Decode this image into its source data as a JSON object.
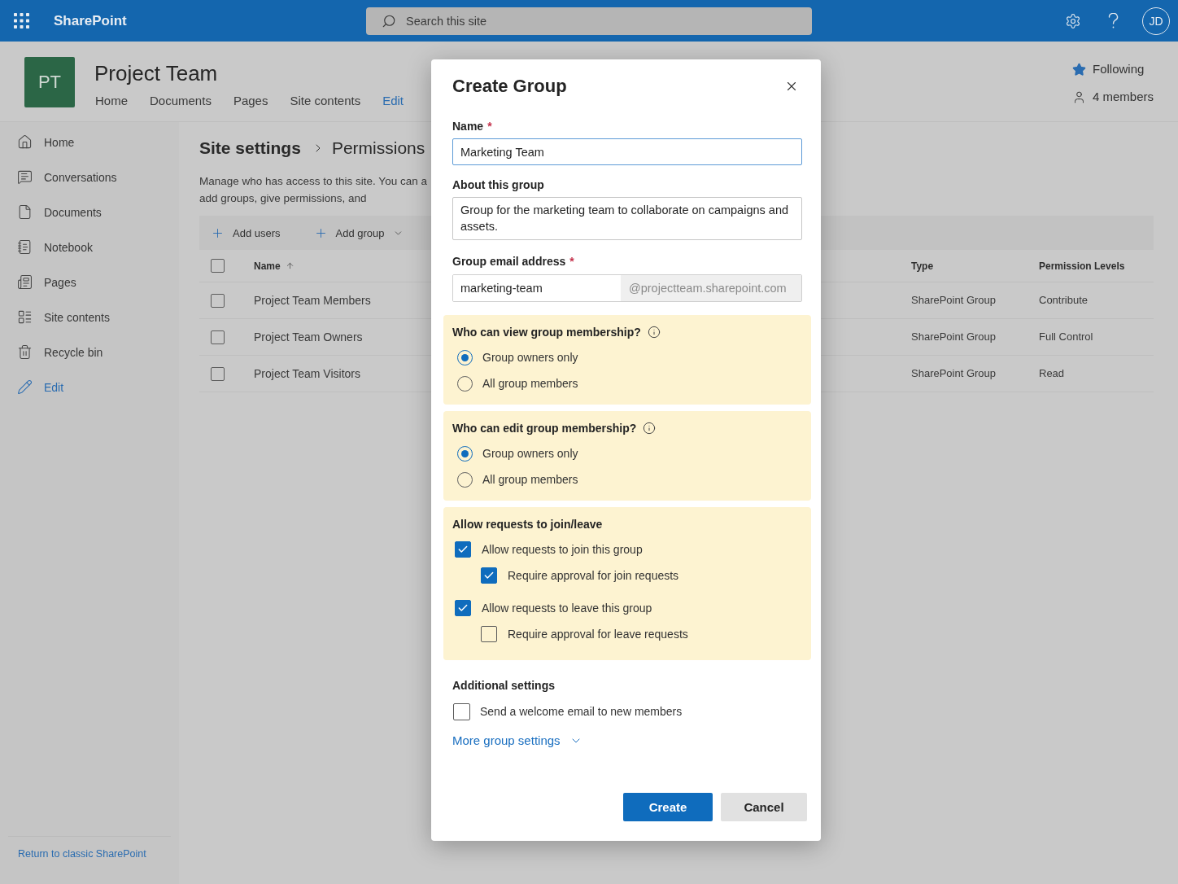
{
  "top_bar": {
    "app_name": "SharePoint",
    "search": {
      "placeholder": "Search this site"
    },
    "avatar": "JD"
  },
  "site_header": {
    "logo": "PT",
    "title": "Project Team",
    "nav": [
      {
        "label": "Home",
        "kind": "page"
      },
      {
        "label": "Documents",
        "kind": "page"
      },
      {
        "label": "Pages",
        "kind": "page"
      },
      {
        "label": "Site contents",
        "kind": "page"
      },
      {
        "label": "Edit",
        "kind": "action"
      }
    ],
    "following": "Following",
    "members": "4 members"
  },
  "left_nav": {
    "items": [
      {
        "label": "Home",
        "kind": "page"
      },
      {
        "label": "Conversations",
        "kind": "page"
      },
      {
        "label": "Documents",
        "kind": "page"
      },
      {
        "label": "Notebook",
        "kind": "page"
      },
      {
        "label": "Pages",
        "kind": "page"
      },
      {
        "label": "Site contents",
        "kind": "page"
      },
      {
        "label": "Recycle bin",
        "kind": "page"
      },
      {
        "label": "Edit",
        "kind": "action"
      }
    ],
    "footer_link": "Return to classic SharePoint"
  },
  "main": {
    "breadcrumb": [
      {
        "label": "Site settings",
        "kind": "parent"
      },
      {
        "label": "Permissions",
        "kind": "current"
      }
    ],
    "description_lines": [
      "Manage who has access to this site. You can a",
      "add groups, give permissions, and"
    ],
    "commands": [
      {
        "label": "Add users",
        "kind": "button"
      },
      {
        "label": "Add group",
        "kind": "menu"
      }
    ],
    "table": {
      "select_all": {
        "checked": false
      },
      "columns": [
        {
          "label": "Name",
          "sorted": true
        },
        {
          "label": "Type",
          "sorted": false
        },
        {
          "label": "Permission Levels",
          "sorted": false
        }
      ],
      "rows": [
        {
          "name": "Project Team Members",
          "type": "SharePoint Group",
          "permission_level": "Contribute",
          "checked": false
        },
        {
          "name": "Project Team Owners",
          "type": "SharePoint Group",
          "permission_level": "Full Control",
          "checked": false
        },
        {
          "name": "Project Team Visitors",
          "type": "SharePoint Group",
          "permission_level": "Read",
          "checked": false
        }
      ]
    }
  },
  "dialog": {
    "title": "Create Group",
    "fields": [
      {
        "kind": "text",
        "label": "Name",
        "required_mark": "*",
        "value": "Marketing Team",
        "focused": true
      },
      {
        "kind": "textarea",
        "label": "About this group",
        "value": "Group for the marketing team to collaborate on campaigns and assets.",
        "focused": false
      },
      {
        "kind": "email",
        "label": "Group email address",
        "required_mark": "*",
        "value": "marketing-team",
        "suffix": "@projectteam.sharepoint.com",
        "focused": false
      }
    ],
    "sections": [
      {
        "kind": "radio",
        "title": "Who can view group membership?",
        "info": true,
        "options": [
          {
            "label": "Group owners only",
            "selected": true
          },
          {
            "label": "All group members",
            "selected": false
          }
        ]
      },
      {
        "kind": "radio",
        "title": "Who can edit group membership?",
        "info": true,
        "options": [
          {
            "label": "Group owners only",
            "selected": true
          },
          {
            "label": "All group members",
            "selected": false
          }
        ]
      },
      {
        "kind": "checkbox",
        "title": "Allow requests to join/leave",
        "info": false,
        "options": [
          {
            "label": "Allow requests to join this group",
            "checked": true,
            "children": [
              {
                "label": "Require approval for join requests",
                "checked": true
              }
            ]
          },
          {
            "label": "Allow requests to leave this group",
            "checked": true,
            "children": [
              {
                "label": "Require approval for leave requests",
                "checked": false
              }
            ]
          }
        ]
      }
    ],
    "additional": {
      "title": "Additional settings",
      "options": [
        {
          "label": "Send a welcome email to new members",
          "checked": false
        }
      ]
    },
    "more_link": "More group settings",
    "buttons": [
      {
        "label": "Create",
        "kind": "primary"
      },
      {
        "label": "Cancel",
        "kind": "secondary"
      }
    ]
  }
}
